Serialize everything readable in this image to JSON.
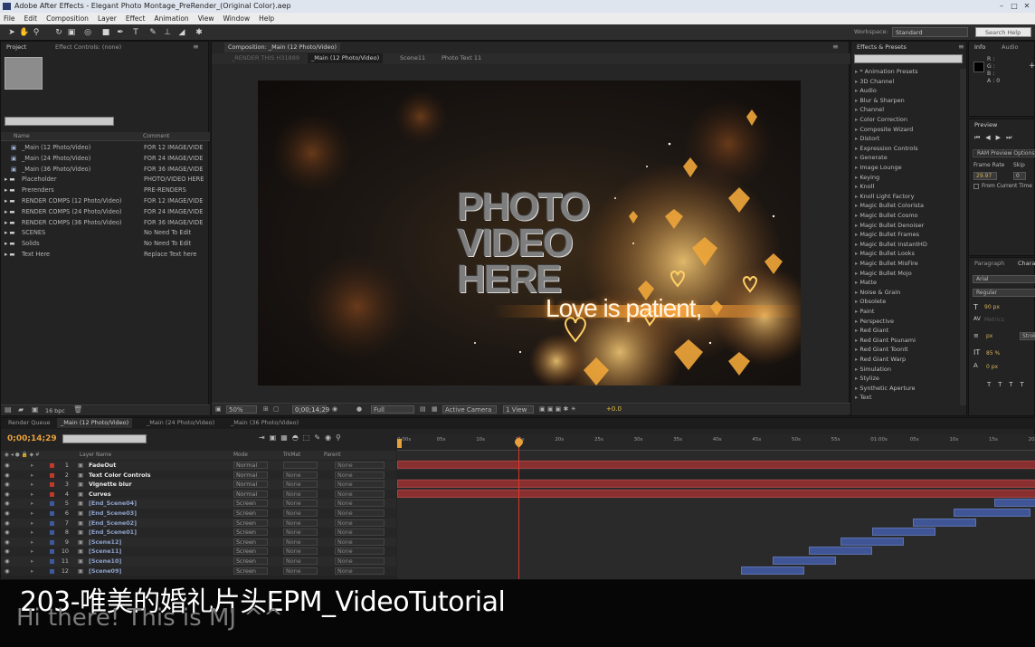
{
  "window": {
    "title": "Adobe After Effects - Elegant Photo Montage_PreRender_(Original Color).aep"
  },
  "menu": [
    "File",
    "Edit",
    "Composition",
    "Layer",
    "Effect",
    "Animation",
    "View",
    "Window",
    "Help"
  ],
  "toolbar": {
    "workspace_label": "Workspace:",
    "workspace_value": "Standard",
    "search_placeholder": "Search Help"
  },
  "project": {
    "tabs": [
      "Project",
      "Effect Controls: (none)"
    ],
    "columns": [
      "Name",
      "Comment"
    ],
    "items": [
      {
        "name": "_Main (12 Photo/Video)",
        "comment": "FOR 12 IMAGE/VIDE",
        "type": "comp"
      },
      {
        "name": "_Main (24 Photo/Video)",
        "comment": "FOR 24 IMAGE/VIDE",
        "type": "comp"
      },
      {
        "name": "_Main (36 Photo/Video)",
        "comment": "FOR 36 IMAGE/VIDE",
        "type": "comp"
      },
      {
        "name": "Placeholder",
        "comment": "PHOTO/VIDEO HERE",
        "type": "folder"
      },
      {
        "name": "Prerenders",
        "comment": "PRE-RENDERS",
        "type": "folder"
      },
      {
        "name": "RENDER COMPS (12 Photo/Video)",
        "comment": "FOR 12 IMAGE/VIDE",
        "type": "folder"
      },
      {
        "name": "RENDER COMPS (24 Photo/Video)",
        "comment": "FOR 24 IMAGE/VIDE",
        "type": "folder"
      },
      {
        "name": "RENDER COMPS (36 Photo/Video)",
        "comment": "FOR 36 IMAGE/VIDE",
        "type": "folder"
      },
      {
        "name": "SCENES",
        "comment": "No Need To Edit",
        "type": "folder"
      },
      {
        "name": "Solids",
        "comment": "No Need To Edit",
        "type": "folder"
      },
      {
        "name": "Text Here",
        "comment": "Replace Text here",
        "type": "folder"
      }
    ],
    "bpc": "16 bpc"
  },
  "composition": {
    "tab": "Composition: _Main (12 Photo/Video)",
    "breadcrumbs": [
      "_RENDER THIS H31889",
      "_Main (12 Photo/Video)",
      "Scene11",
      "Photo Text 11"
    ],
    "preview_text": {
      "line1": "PHOTO",
      "line2": "VIDEO",
      "line3": "HERE",
      "caption": "Love is patient,"
    },
    "footer": {
      "zoom": "50%",
      "timecode": "0;00;14;29",
      "resolution": "Full",
      "camera": "Active Camera",
      "view": "1 View",
      "exposure": "+0.0"
    }
  },
  "effects": {
    "tab": "Effects & Presets",
    "items": [
      "* Animation Presets",
      "3D Channel",
      "Audio",
      "Blur & Sharpen",
      "Channel",
      "Color Correction",
      "Composite Wizard",
      "Distort",
      "Expression Controls",
      "Generate",
      "Image Lounge",
      "Keying",
      "Knoll",
      "Knoll Light Factory",
      "Magic Bullet Colorista",
      "Magic Bullet Cosmo",
      "Magic Bullet Denoiser",
      "Magic Bullet Frames",
      "Magic Bullet InstantHD",
      "Magic Bullet Looks",
      "Magic Bullet MisFire",
      "Magic Bullet Mojo",
      "Matte",
      "Noise & Grain",
      "Obsolete",
      "Paint",
      "Perspective",
      "Red Giant",
      "Red Giant Psunami",
      "Red Giant ToonIt",
      "Red Giant Warp",
      "Simulation",
      "Stylize",
      "Synthetic Aperture",
      "Text"
    ]
  },
  "info": {
    "tabs": [
      "Info",
      "Audio"
    ],
    "values": [
      "R :",
      "G :",
      "B :",
      "A : 0"
    ]
  },
  "preview": {
    "tab": "Preview",
    "ram_option": "RAM Preview Options",
    "frame_rate_label": "Frame Rate",
    "skip_label": "Skip",
    "frame_rate": "29.97",
    "skip": "0",
    "from_current": "From Current Time"
  },
  "paragraph": {
    "tabs": [
      "Paragraph",
      "Chara"
    ],
    "font": "Arial",
    "style": "Regular",
    "size": "90 px",
    "metrics": "Metrics",
    "stroke": "px",
    "stroke_label": "Strok",
    "vscale": "85 %",
    "baseline": "0 px"
  },
  "timeline": {
    "tabs": [
      "Render Queue",
      "_Main (12 Photo/Video)",
      "_Main (24 Photo/Video)",
      "_Main (36 Photo/Video)"
    ],
    "timecode": "0;00;14;29",
    "header": {
      "layer_name": "Layer Name",
      "mode": "Mode",
      "trkmat": "TrkMat",
      "parent": "Parent"
    },
    "ruler": [
      "0:00s",
      "05s",
      "10s",
      "15s",
      "20s",
      "25s",
      "30s",
      "35s",
      "40s",
      "45s",
      "50s",
      "55s",
      "01:00s",
      "05s",
      "10s",
      "15s",
      "20s"
    ],
    "layers": [
      {
        "num": "1",
        "name": "FadeOut",
        "color": "#c0392b",
        "mode": "Normal",
        "trkmat": "",
        "parent": "None"
      },
      {
        "num": "2",
        "name": "Text Color Controls",
        "color": "#c0392b",
        "mode": "Normal",
        "trkmat": "None",
        "parent": "None"
      },
      {
        "num": "3",
        "name": "Vignette blur",
        "color": "#c0392b",
        "mode": "Normal",
        "trkmat": "None",
        "parent": "None"
      },
      {
        "num": "4",
        "name": "Curves",
        "color": "#c0392b",
        "mode": "Normal",
        "trkmat": "None",
        "parent": "None"
      },
      {
        "num": "5",
        "name": "[End_Scene04]",
        "color": "#3d5a9e",
        "mode": "Screen",
        "trkmat": "None",
        "parent": "None"
      },
      {
        "num": "6",
        "name": "[End_Scene03]",
        "color": "#3d5a9e",
        "mode": "Screen",
        "trkmat": "None",
        "parent": "None"
      },
      {
        "num": "7",
        "name": "[End_Scene02]",
        "color": "#3d5a9e",
        "mode": "Screen",
        "trkmat": "None",
        "parent": "None"
      },
      {
        "num": "8",
        "name": "[End_Scene01]",
        "color": "#3d5a9e",
        "mode": "Screen",
        "trkmat": "None",
        "parent": "None"
      },
      {
        "num": "9",
        "name": "[Scene12]",
        "color": "#3d5a9e",
        "mode": "Screen",
        "trkmat": "None",
        "parent": "None"
      },
      {
        "num": "10",
        "name": "[Scene11]",
        "color": "#3d5a9e",
        "mode": "Screen",
        "trkmat": "None",
        "parent": "None"
      },
      {
        "num": "11",
        "name": "[Scene10]",
        "color": "#3d5a9e",
        "mode": "Screen",
        "trkmat": "None",
        "parent": "None"
      },
      {
        "num": "12",
        "name": "[Scene09]",
        "color": "#3d5a9e",
        "mode": "Screen",
        "trkmat": "None",
        "parent": "None"
      }
    ]
  },
  "overlay": {
    "subtitle": "203-唯美的婚礼片头EPM_VideoTutorial",
    "greeting": "Hi there! This is MJ ^^"
  },
  "colors": {
    "accent_orange": "#e8a13a",
    "timeline_red": "#8a2f2f",
    "timeline_blue": "#3f5596",
    "playhead": "#d6372a"
  }
}
